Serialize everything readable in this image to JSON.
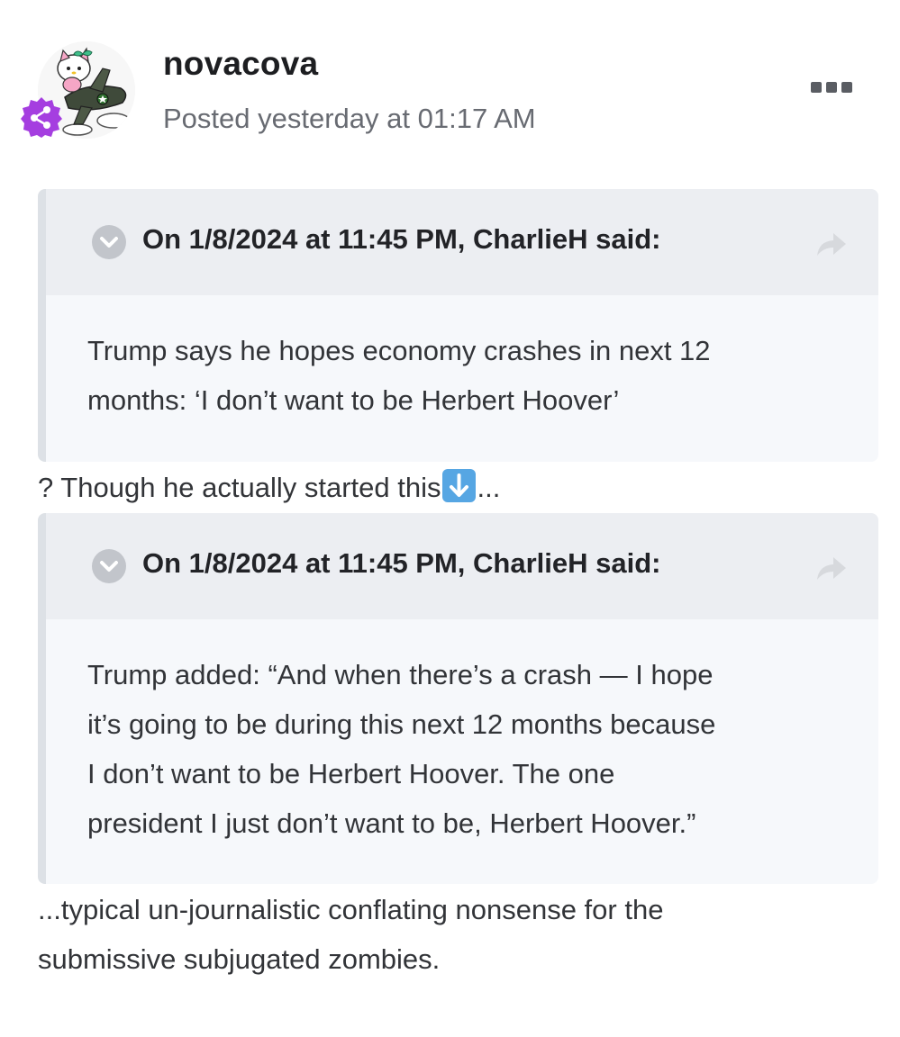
{
  "post": {
    "username": "novacova",
    "posted": "Posted yesterday at 01:17 AM"
  },
  "quotes": [
    {
      "cite": "On 1/8/2024 at 11:45 PM, CharlieH said:",
      "lines": [
        "Trump says he hopes economy crashes in next 12",
        "months: ‘I don’t want to be Herbert Hoover’"
      ]
    },
    {
      "cite": "On 1/8/2024 at 11:45 PM, CharlieH said:",
      "lines": [
        "Trump added: “And when there’s a crash — I hope",
        "it’s going to be during this next 12 months because",
        "I don’t want to be Herbert Hoover. The one",
        "president I just don’t want to be, Herbert Hoover.”"
      ]
    }
  ],
  "between_text": {
    "before_emoji": "? Though he actually started this",
    "after_emoji": "..."
  },
  "closing_lines": [
    "...typical un-journalistic conflating nonsense for the",
    "submissive subjugated zombies."
  ],
  "icons": {
    "group_badge": "share-nodes-icon",
    "quote_toggle": "chevron-down-icon",
    "quote_jump": "share-arrow-icon",
    "emoji": "down-arrow-emoji",
    "more": "ellipsis-icon"
  },
  "colors": {
    "badge": "#a53ee0",
    "emoji": "#56a6e3",
    "quote_bg": "#f6f8fb",
    "quote_header_bg": "#eceef2"
  }
}
